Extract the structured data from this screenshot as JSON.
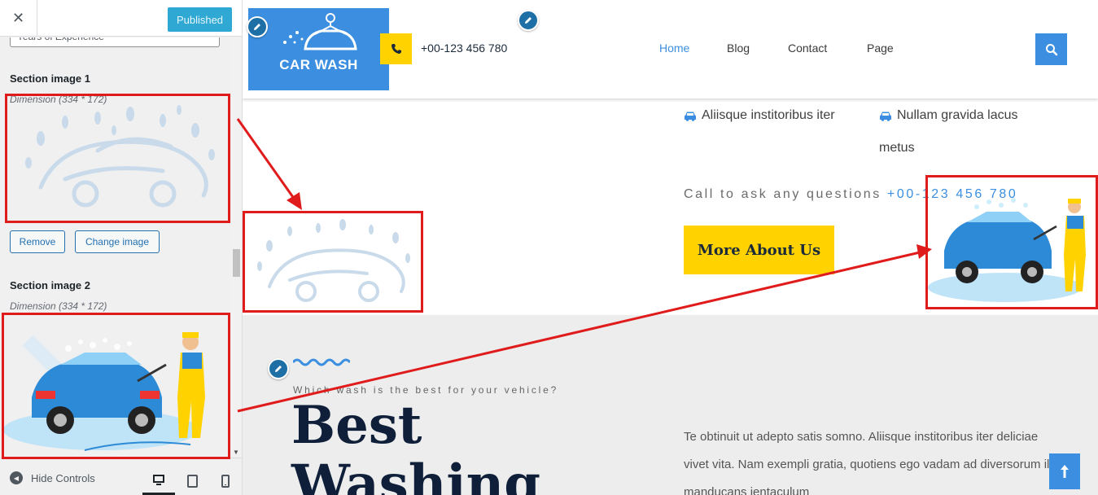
{
  "sidebar": {
    "close_label": "✕",
    "published_label": "Published",
    "prev_field_value": "Years of Experience",
    "section1": {
      "label": "Section image 1",
      "dimension": "Dimension (334 * 172)",
      "remove_label": "Remove",
      "change_label": "Change image"
    },
    "section2": {
      "label": "Section image 2",
      "dimension": "Dimension (334 * 172)"
    },
    "footer": {
      "hide_controls_label": "Hide Controls",
      "devices": [
        "desktop",
        "tablet",
        "mobile"
      ],
      "active_device": "desktop"
    }
  },
  "site": {
    "logo_text": "CAR WASH",
    "phone": "+00-123 456 780",
    "menu": [
      {
        "label": "Home",
        "active": true
      },
      {
        "label": "Blog",
        "active": false
      },
      {
        "label": "Contact",
        "active": false
      },
      {
        "label": "Page",
        "active": false
      }
    ],
    "features": [
      {
        "text": "Aliisque institoribus iter",
        "icon": "car-icon"
      },
      {
        "text": "Nullam gravida lacus",
        "icon": "car-icon"
      },
      {
        "text": "metus",
        "icon": ""
      }
    ],
    "call_text": "Call to ask any questions",
    "call_phone": "+00-123 456 780",
    "more_button": "More About Us",
    "section2": {
      "tagline": "Which wash is the best for your vehicle?",
      "title_line1": "Best",
      "title_line2": "Washing",
      "paragraph": "Te obtinuit ut adepto satis somno. Aliisque institoribus iter deliciae vivet vita. Nam exempli gratia, quotiens ego vadam ad diversorum illis manducans ientaculum"
    }
  },
  "colors": {
    "brand_blue": "#3c8fe0",
    "accent_yellow": "#ffd200",
    "annotation_red": "#e01b1b",
    "wp_blue": "#2271b1"
  }
}
